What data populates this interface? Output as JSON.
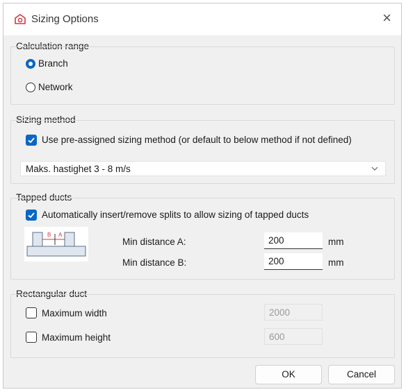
{
  "window": {
    "title": "Sizing Options",
    "close_symbol": "×"
  },
  "calc_range": {
    "label": "Calculation range",
    "options": [
      {
        "label": "Branch",
        "selected": true
      },
      {
        "label": "Network",
        "selected": false
      }
    ]
  },
  "sizing_method": {
    "label": "Sizing method",
    "checkbox_label": "Use pre-assigned sizing method (or default to below method if not defined)",
    "checked": true,
    "selected": "Maks. hastighet 3 - 8 m/s"
  },
  "tapped_ducts": {
    "label": "Tapped ducts",
    "checkbox_label": "Automatically insert/remove splits to allow sizing of tapped ducts",
    "checked": true,
    "min_a_label": "Min distance A:",
    "min_a_value": "200",
    "min_b_label": "Min distance B:",
    "min_b_value": "200",
    "unit": "mm",
    "diagram_label_a": "A",
    "diagram_label_b": "B"
  },
  "rect_duct": {
    "label": "Rectangular duct",
    "max_width_label": "Maximum width",
    "max_width_value": "2000",
    "max_width_checked": false,
    "max_height_label": "Maximum height",
    "max_height_value": "600",
    "max_height_checked": false
  },
  "buttons": {
    "ok": "OK",
    "cancel": "Cancel"
  },
  "colors": {
    "accent": "#0a67c4",
    "app_icon": "#d9343a"
  }
}
